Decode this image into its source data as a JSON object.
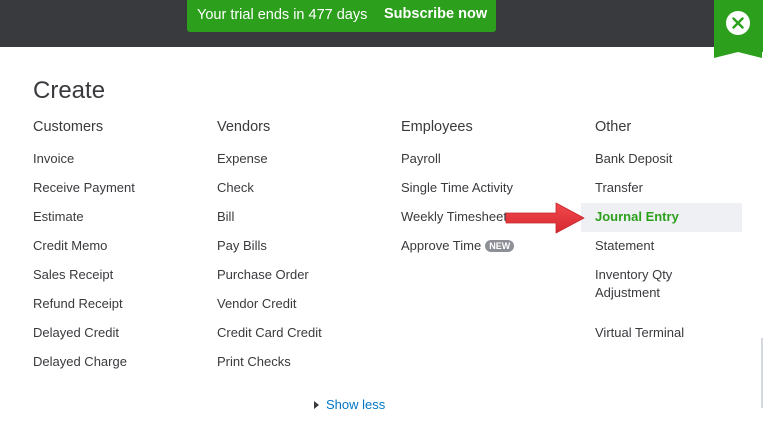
{
  "banner": {
    "trial_text": "Your trial ends in 477 days",
    "subscribe_label": "Subscribe now"
  },
  "close": {
    "icon": "close-icon"
  },
  "title": "Create",
  "columns": [
    {
      "header": "Customers",
      "items": [
        "Invoice",
        "Receive Payment",
        "Estimate",
        "Credit Memo",
        "Sales Receipt",
        "Refund Receipt",
        "Delayed Credit",
        "Delayed Charge"
      ]
    },
    {
      "header": "Vendors",
      "items": [
        "Expense",
        "Check",
        "Bill",
        "Pay Bills",
        "Purchase Order",
        "Vendor Credit",
        "Credit Card Credit",
        "Print Checks"
      ]
    },
    {
      "header": "Employees",
      "items": [
        "Payroll",
        "Single Time Activity",
        "Weekly Timesheet",
        "Approve Time"
      ],
      "badge": "NEW"
    },
    {
      "header": "Other",
      "items": [
        "Bank Deposit",
        "Transfer",
        "Journal Entry",
        "Statement",
        "Inventory Qty Adjustment",
        "Virtual Terminal"
      ],
      "active": "Journal Entry"
    }
  ],
  "show_less": "Show less",
  "colors": {
    "green": "#2ca01c",
    "dark": "#393a3d",
    "link": "#0077c5",
    "arrow": "#e8353b"
  }
}
